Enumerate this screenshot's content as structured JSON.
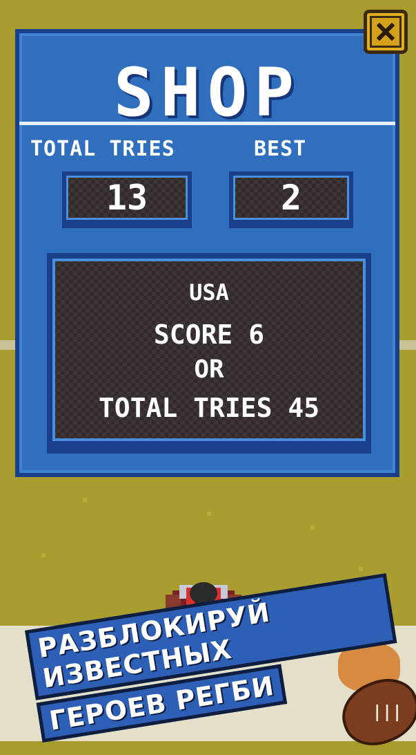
{
  "shop": {
    "title": "SHOP",
    "total_tries_label": "TOTAL TRIES",
    "best_label": "BEST",
    "total_tries_value": "13",
    "best_value": "2"
  },
  "unlock": {
    "country": "USA",
    "score_req": "SCORE 6",
    "or": "OR",
    "tries_req": "TOTAL TRIES 45"
  },
  "promo": {
    "line1": "РАЗБЛОКИРУЙ ИЗВЕСТНЫХ",
    "line2": "ГЕРОЕВ РЕГБИ"
  },
  "icons": {
    "close": "close-x-icon",
    "ball": "rugby-ball-icon"
  },
  "colors": {
    "field": "#a89d2e",
    "panel": "#2f6fbd",
    "panel_border": "#1a3f8a",
    "close_button": "#e0b020"
  }
}
